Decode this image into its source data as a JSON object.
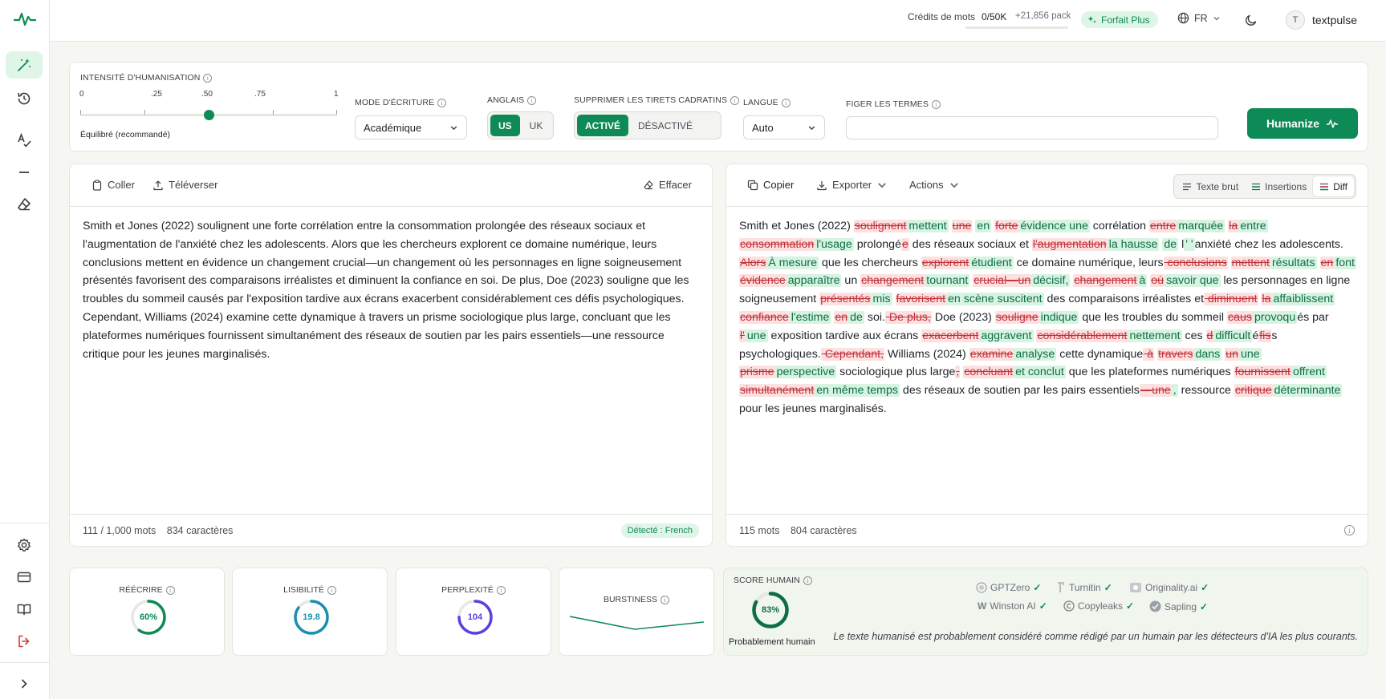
{
  "app": {
    "username": "textpulse",
    "avatar_initial": "T"
  },
  "topbar": {
    "credits_label": "Crédits de mots",
    "credits_value": "0/50K",
    "credits_pack": "+21,856 pack",
    "credits_used_fraction": 0.0,
    "plan_label": "Forfait Plus",
    "language": "FR"
  },
  "settings": {
    "intensity": {
      "label": "INTENSITÉ D'HUMANISATION",
      "ticks": [
        "0",
        ".25",
        ".50",
        ".75",
        "1"
      ],
      "value": 0.5,
      "caption": "Équilibré (recommandé)"
    },
    "writing_mode": {
      "label": "MODE D'ÉCRITURE",
      "value": "Académique"
    },
    "english": {
      "label": "ANGLAIS",
      "options": [
        "US",
        "UK"
      ],
      "selected": "US"
    },
    "em_dash": {
      "label": "SUPPRIMER LES TIRETS CADRATINS",
      "options": [
        "ACTIVÉ",
        "DÉSACTIVÉ"
      ],
      "selected": "ACTIVÉ"
    },
    "language": {
      "label": "LANGUE",
      "value": "Auto"
    },
    "freeze_terms": {
      "label": "FIGER LES TERMES",
      "value": "",
      "placeholder": ""
    },
    "humanize_label": "Humanize"
  },
  "input_panel": {
    "paste_label": "Coller",
    "upload_label": "Téléverser",
    "clear_label": "Effacer",
    "text": "Smith et Jones (2022) soulignent une forte corrélation entre la consommation prolongée des réseaux sociaux et l'augmentation de l'anxiété chez les adolescents. Alors que les chercheurs explorent ce domaine numérique, leurs conclusions mettent en évidence un changement crucial—un changement où les personnages en ligne soigneusement présentés favorisent des comparaisons irréalistes et diminuent la confiance en soi. De plus, Doe (2023) souligne que les troubles du sommeil causés par l'exposition tardive aux écrans exacerbent considérablement ces défis psychologiques. Cependant, Williams (2024) examine cette dynamique à travers un prisme sociologique plus large, concluant que les plateformes numériques fournissent simultanément des réseaux de soutien par les pairs essentiels—une ressource critique pour les jeunes marginalisés.",
    "word_count": "111 / 1,000 mots",
    "char_count": "834 caractères",
    "detected": "Détecté : French"
  },
  "output_panel": {
    "copy_label": "Copier",
    "export_label": "Exporter",
    "actions_label": "Actions",
    "view_modes": [
      "Texte brut",
      "Insertions",
      "Diff"
    ],
    "view_selected": "Diff",
    "word_count": "115 mots",
    "char_count": "804 caractères",
    "diff": [
      {
        "t": "eq",
        "s": "Smith et Jones (2022) "
      },
      {
        "t": "del",
        "s": "soulignent"
      },
      {
        "t": "ins",
        "s": "mettent"
      },
      {
        "t": "eq",
        "s": " "
      },
      {
        "t": "del",
        "s": "une"
      },
      {
        "t": "eq",
        "s": " "
      },
      {
        "t": "ins",
        "s": "en"
      },
      {
        "t": "eq",
        "s": " "
      },
      {
        "t": "del",
        "s": "forte"
      },
      {
        "t": "ins",
        "s": "évidence une"
      },
      {
        "t": "eq",
        "s": " corrélation "
      },
      {
        "t": "del",
        "s": "entre"
      },
      {
        "t": "ins",
        "s": "marquée"
      },
      {
        "t": "eq",
        "s": " "
      },
      {
        "t": "del",
        "s": "la"
      },
      {
        "t": "ins",
        "s": "entre"
      },
      {
        "t": "eq",
        "s": " "
      },
      {
        "t": "del",
        "s": "consommation"
      },
      {
        "t": "ins",
        "s": "l'usage"
      },
      {
        "t": "eq",
        "s": " prolongé"
      },
      {
        "t": "del",
        "s": "e"
      },
      {
        "t": "eq",
        "s": " des réseaux sociaux et "
      },
      {
        "t": "del",
        "s": "l'augmentation"
      },
      {
        "t": "ins",
        "s": "la hausse"
      },
      {
        "t": "eq",
        "s": " "
      },
      {
        "t": "ins",
        "s": "de"
      },
      {
        "t": "eq",
        "s": " l"
      },
      {
        "t": "ins",
        "s": "' '"
      },
      {
        "t": "eq",
        "s": "anxiété chez les "
      },
      {
        "t": "eq",
        "s": "adolescents. "
      },
      {
        "t": "del",
        "s": "Alors"
      },
      {
        "t": "ins",
        "s": "À mesure"
      },
      {
        "t": "eq",
        "s": " que les chercheurs "
      },
      {
        "t": "del",
        "s": "explorent"
      },
      {
        "t": "ins",
        "s": "étudient"
      },
      {
        "t": "eq",
        "s": " ce domaine numérique, leurs"
      },
      {
        "t": "del",
        "s": " conclusions"
      },
      {
        "t": "eq",
        "s": " "
      },
      {
        "t": "del",
        "s": "mettent"
      },
      {
        "t": "ins",
        "s": "résultats"
      },
      {
        "t": "eq",
        "s": " "
      },
      {
        "t": "del",
        "s": "en"
      },
      {
        "t": "ins",
        "s": "font"
      },
      {
        "t": "eq",
        "s": " "
      },
      {
        "t": "del",
        "s": "évidence"
      },
      {
        "t": "ins",
        "s": "apparaître"
      },
      {
        "t": "eq",
        "s": " un "
      },
      {
        "t": "del",
        "s": "changement"
      },
      {
        "t": "ins",
        "s": "tournant"
      },
      {
        "t": "eq",
        "s": " "
      },
      {
        "t": "del",
        "s": "crucial—un"
      },
      {
        "t": "ins",
        "s": "décisif,"
      },
      {
        "t": "eq",
        "s": " "
      },
      {
        "t": "del",
        "s": "changement"
      },
      {
        "t": "ins",
        "s": "à"
      },
      {
        "t": "eq",
        "s": " "
      },
      {
        "t": "del",
        "s": "où"
      },
      {
        "t": "ins",
        "s": "savoir que"
      },
      {
        "t": "eq",
        "s": " les personnages en ligne soigneusement "
      },
      {
        "t": "del",
        "s": "présentés"
      },
      {
        "t": "ins",
        "s": "mis"
      },
      {
        "t": "eq",
        "s": " "
      },
      {
        "t": "del",
        "s": "favorisent"
      },
      {
        "t": "ins",
        "s": "en scène suscitent"
      },
      {
        "t": "eq",
        "s": " des "
      },
      {
        "t": "eq",
        "s": "comparaisons irréalistes et"
      },
      {
        "t": "del",
        "s": " diminuent"
      },
      {
        "t": "eq",
        "s": " "
      },
      {
        "t": "del",
        "s": "la"
      },
      {
        "t": "ins",
        "s": "affaiblissent"
      },
      {
        "t": "eq",
        "s": " "
      },
      {
        "t": "del",
        "s": "confiance"
      },
      {
        "t": "ins",
        "s": "l'estime"
      },
      {
        "t": "eq",
        "s": " "
      },
      {
        "t": "del",
        "s": "en"
      },
      {
        "t": "ins",
        "s": "de"
      },
      {
        "t": "eq",
        "s": " soi."
      },
      {
        "t": "del",
        "s": " De plus,"
      },
      {
        "t": "eq",
        "s": " Doe (2023) "
      },
      {
        "t": "del",
        "s": "souligne"
      },
      {
        "t": "ins",
        "s": "indique"
      },
      {
        "t": "eq",
        "s": " que les troubles du sommeil "
      },
      {
        "t": "del",
        "s": "caus"
      },
      {
        "t": "ins",
        "s": "provoqu"
      },
      {
        "t": "eq",
        "s": "és par "
      },
      {
        "t": "del",
        "s": "l'"
      },
      {
        "t": "ins",
        "s": "une"
      },
      {
        "t": "eq",
        "s": " exposition tardive aux écrans "
      },
      {
        "t": "del",
        "s": "exacerbent"
      },
      {
        "t": "ins",
        "s": "aggravent"
      },
      {
        "t": "eq",
        "s": " "
      },
      {
        "t": "del",
        "s": "considérablement"
      },
      {
        "t": "ins",
        "s": "nettement"
      },
      {
        "t": "eq",
        "s": " ces "
      },
      {
        "t": "del",
        "s": "d"
      },
      {
        "t": "ins",
        "s": "difficult"
      },
      {
        "t": "eq",
        "s": "é"
      },
      {
        "t": "del",
        "s": "fis"
      },
      {
        "t": "eq",
        "s": "s psychologiques."
      },
      {
        "t": "del",
        "s": " Cependant,"
      },
      {
        "t": "eq",
        "s": " Williams "
      },
      {
        "t": "eq",
        "s": "(2024) "
      },
      {
        "t": "del",
        "s": "examine"
      },
      {
        "t": "ins",
        "s": "analyse"
      },
      {
        "t": "eq",
        "s": " cette dynamique"
      },
      {
        "t": "del",
        "s": " à"
      },
      {
        "t": "eq",
        "s": " "
      },
      {
        "t": "del",
        "s": "travers"
      },
      {
        "t": "ins",
        "s": "dans"
      },
      {
        "t": "eq",
        "s": " "
      },
      {
        "t": "del",
        "s": "un"
      },
      {
        "t": "ins",
        "s": "une"
      },
      {
        "t": "eq",
        "s": " "
      },
      {
        "t": "del",
        "s": "prisme"
      },
      {
        "t": "ins",
        "s": "perspective"
      },
      {
        "t": "eq",
        "s": " sociologique plus large"
      },
      {
        "t": "del",
        "s": ","
      },
      {
        "t": "eq",
        "s": " "
      },
      {
        "t": "del",
        "s": "concluant"
      },
      {
        "t": "ins",
        "s": "et conclut"
      },
      {
        "t": "eq",
        "s": " que les plateformes numériques "
      },
      {
        "t": "del",
        "s": "fournissent"
      },
      {
        "t": "ins",
        "s": "offrent"
      },
      {
        "t": "eq",
        "s": " "
      },
      {
        "t": "del",
        "s": "simultanément"
      },
      {
        "t": "ins",
        "s": "en même temps"
      },
      {
        "t": "eq",
        "s": " des "
      },
      {
        "t": "eq",
        "s": "réseaux de soutien par les pairs essentiels"
      },
      {
        "t": "del",
        "s": "—une"
      },
      {
        "t": "ins",
        "s": ","
      },
      {
        "t": "eq",
        "s": " ressource "
      },
      {
        "t": "del",
        "s": "critique"
      },
      {
        "t": "ins",
        "s": "déterminante"
      },
      {
        "t": "eq",
        "s": " pour les jeunes marginalisés."
      }
    ]
  },
  "metrics": [
    {
      "label": "RÉÉCRIRE",
      "value": "60%",
      "fraction": 0.6,
      "color": "#0d8a55"
    },
    {
      "label": "LISIBILITÉ",
      "value": "19.8",
      "fraction": 0.85,
      "color": "#1a8fb0"
    },
    {
      "label": "PERPLEXITÉ",
      "value": "104",
      "fraction": 0.75,
      "color": "#5b3fe0"
    },
    {
      "label": "BURSTINESS"
    }
  ],
  "score": {
    "label": "SCORE HUMAIN",
    "value": "83%",
    "fraction": 0.83,
    "verdict": "Probablement humain",
    "detectors": [
      "GPTZero",
      "Turnitin",
      "Originality.ai",
      "Winston AI",
      "Copyleaks",
      "Sapling"
    ],
    "note": "Le texte humanisé est probablement considéré comme rédigé par un humain par les détecteurs d'IA les plus courants."
  },
  "colors": {
    "accent": "#0d8a55",
    "deletion": "#c0323a",
    "insertion": "#0d6e45"
  }
}
